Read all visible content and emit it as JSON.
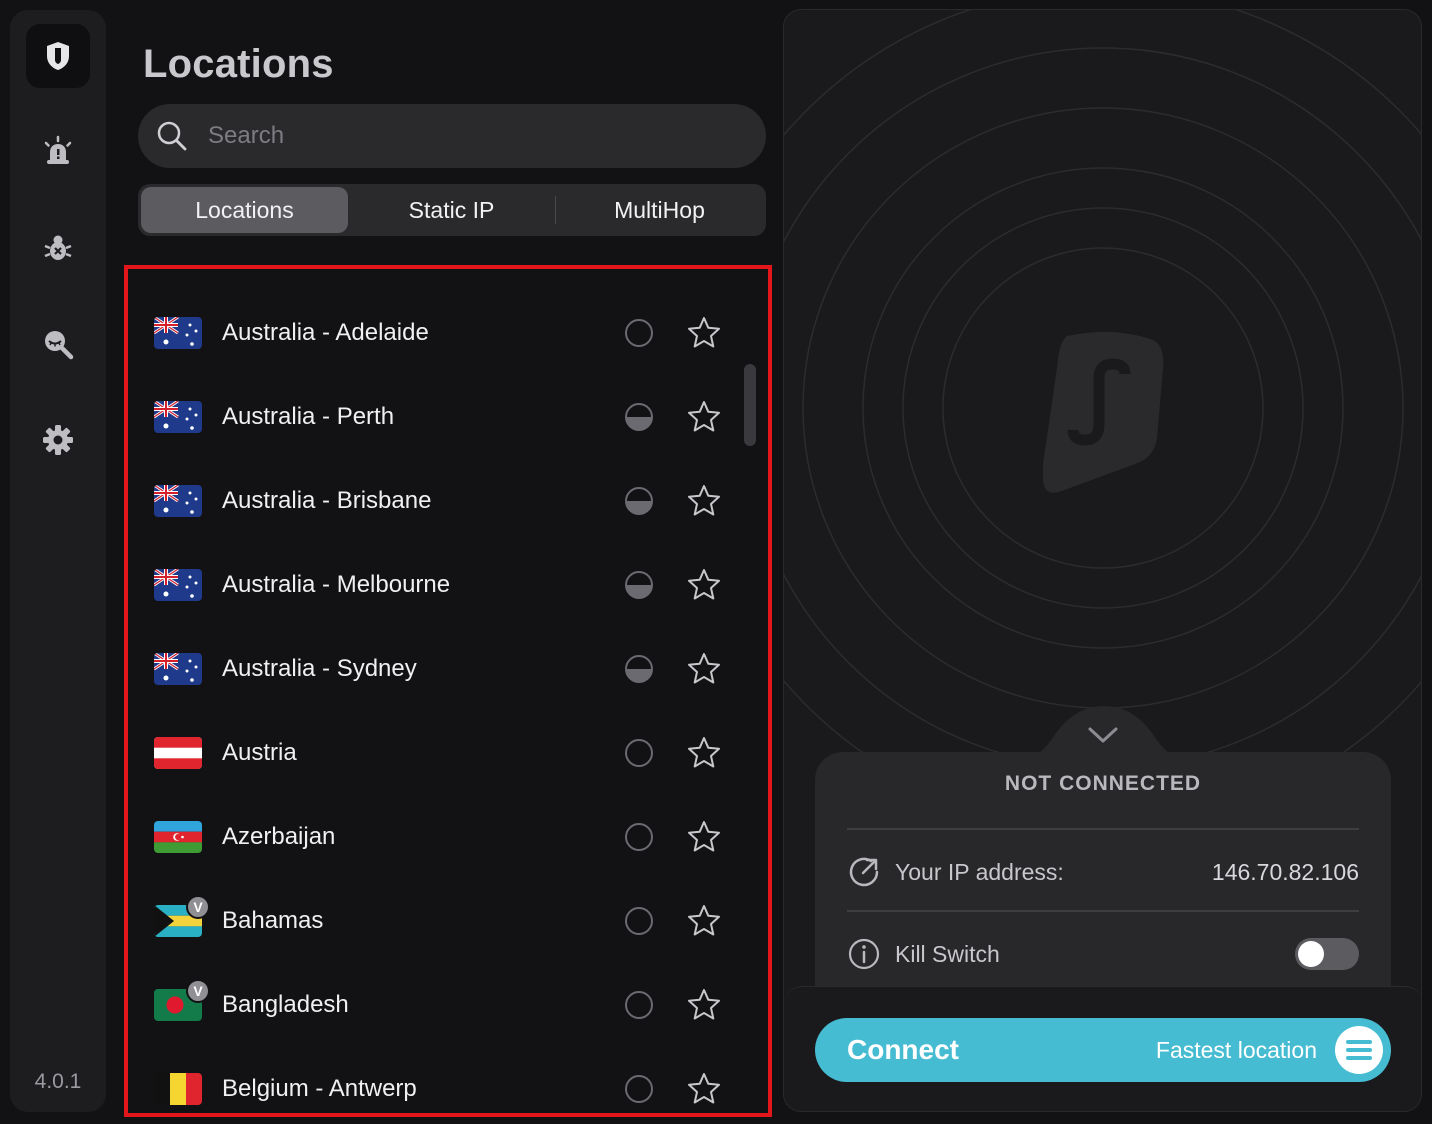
{
  "sidebar": {
    "items": [
      {
        "icon": "shield-icon",
        "active": true
      },
      {
        "icon": "alert-icon",
        "active": false
      },
      {
        "icon": "bug-icon",
        "active": false
      },
      {
        "icon": "search-privacy-icon",
        "active": false
      },
      {
        "icon": "gear-icon",
        "active": false
      }
    ],
    "version": "4.0.1"
  },
  "header": {
    "title": "Locations"
  },
  "search": {
    "placeholder": "Search",
    "icon": "search-icon"
  },
  "tabs": [
    {
      "label": "Locations",
      "active": true
    },
    {
      "label": "Static IP",
      "active": false
    },
    {
      "label": "MultiHop",
      "active": false
    }
  ],
  "locations": [
    {
      "name": "Australia - Adelaide",
      "flag": "australia",
      "virtual": false,
      "load": "low"
    },
    {
      "name": "Australia - Perth",
      "flag": "australia",
      "virtual": false,
      "load": "half"
    },
    {
      "name": "Australia - Brisbane",
      "flag": "australia",
      "virtual": false,
      "load": "half"
    },
    {
      "name": "Australia - Melbourne",
      "flag": "australia",
      "virtual": false,
      "load": "half"
    },
    {
      "name": "Australia - Sydney",
      "flag": "australia",
      "virtual": false,
      "load": "half"
    },
    {
      "name": "Austria",
      "flag": "austria",
      "virtual": false,
      "load": "low"
    },
    {
      "name": "Azerbaijan",
      "flag": "azerbaijan",
      "virtual": false,
      "load": "low"
    },
    {
      "name": "Bahamas",
      "flag": "bahamas",
      "virtual": true,
      "virtual_label": "V",
      "load": "low"
    },
    {
      "name": "Bangladesh",
      "flag": "bangladesh",
      "virtual": true,
      "virtual_label": "V",
      "load": "low"
    },
    {
      "name": "Belgium - Antwerp",
      "flag": "belgium",
      "virtual": false,
      "load": "low"
    }
  ],
  "status": {
    "state": "NOT CONNECTED",
    "ip_label": "Your IP address:",
    "ip_value": "146.70.82.106",
    "kill_switch_label": "Kill Switch",
    "kill_switch_on": false
  },
  "connect": {
    "button_label": "Connect",
    "location_label": "Fastest location"
  },
  "colors": {
    "accent": "#46bcd2",
    "highlight_border": "#e3161c",
    "background": "#121214"
  }
}
